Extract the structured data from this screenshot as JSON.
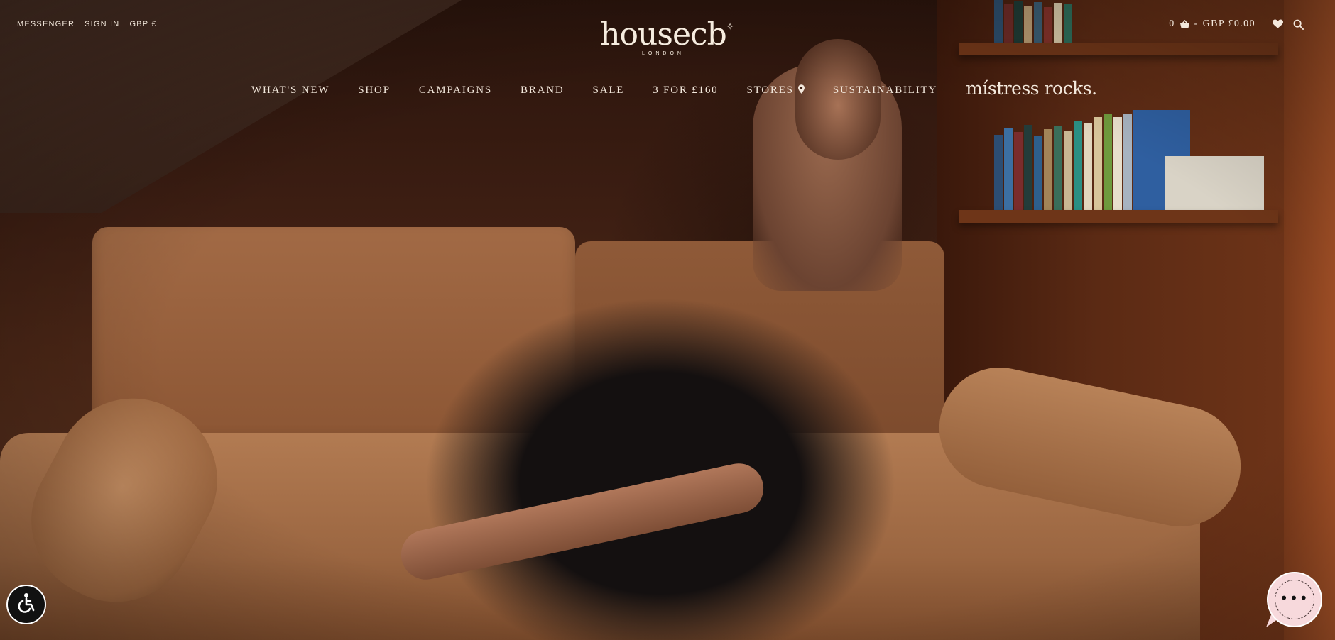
{
  "util_nav": {
    "messenger": "MESSENGER",
    "sign_in": "SIGN IN",
    "currency": "GBP £"
  },
  "logo": {
    "name": "housecb",
    "sub": "LONDON"
  },
  "cart": {
    "count": "0",
    "separator": "-",
    "total": "GBP £0.00"
  },
  "icons": {
    "cart": "basket-icon",
    "wishlist": "heart-icon",
    "search": "search-icon",
    "store": "location-pin-icon",
    "accessibility": "wheelchair-icon",
    "chat": "chat-bubble-icon"
  },
  "nav": {
    "items": [
      "WHAT'S NEW",
      "SHOP",
      "CAMPAIGNS",
      "BRAND",
      "SALE",
      "3 FOR £160",
      "STORES",
      "SUSTAINABILITY"
    ],
    "feature": "místress rocks."
  },
  "chat": {
    "dots": "•••"
  },
  "colors": {
    "nav_text": "#f3e8dc",
    "chat_bubble": "#f7d9dc",
    "accessibility_button": "#111111"
  }
}
